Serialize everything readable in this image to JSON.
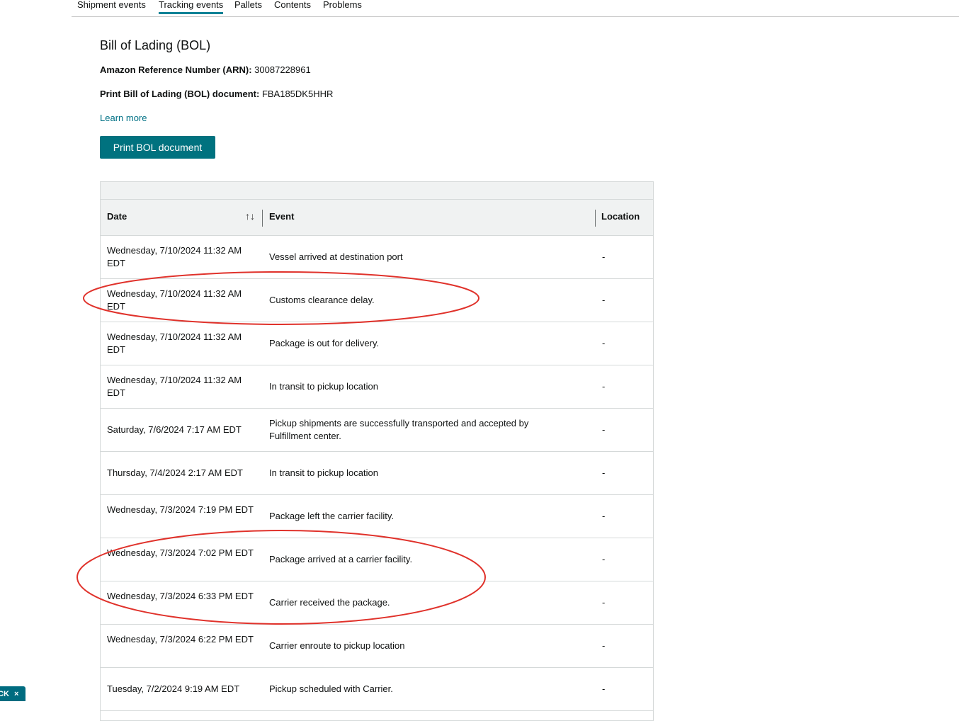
{
  "tabs": [
    "Shipment events",
    "Tracking events",
    "Pallets",
    "Contents",
    "Problems"
  ],
  "active_tab": "Tracking events",
  "bol": {
    "title": "Bill of Lading (BOL)",
    "arn_label": "Amazon Reference Number (ARN):",
    "arn_value": "30087228961",
    "doc_label": "Print Bill of Lading (BOL) document:",
    "doc_value": "FBA185DK5HHR",
    "learn_more": "Learn more",
    "print_button": "Print BOL document"
  },
  "table": {
    "headers": {
      "date": "Date",
      "event": "Event",
      "location": "Location"
    },
    "sort_icon": "↑↓",
    "rows": [
      {
        "date": "Wednesday, 7/10/2024 11:32 AM EDT",
        "event": "Vessel arrived at destination port",
        "location": "-"
      },
      {
        "date": "Wednesday, 7/10/2024 11:32 AM EDT",
        "event": "Customs clearance delay.",
        "location": "-"
      },
      {
        "date": "Wednesday, 7/10/2024 11:32 AM EDT",
        "event": "Package is out for delivery.",
        "location": "-"
      },
      {
        "date": "Wednesday, 7/10/2024 11:32 AM EDT",
        "event": "In transit to pickup location",
        "location": "-"
      },
      {
        "date": "Saturday, 7/6/2024 7:17 AM EDT",
        "event": "Pickup shipments are successfully transported and accepted by Fulfillment center.",
        "location": "-"
      },
      {
        "date": "Thursday, 7/4/2024 2:17 AM EDT",
        "event": "In transit to pickup location",
        "location": "-"
      },
      {
        "date": "Wednesday, 7/3/2024 7:19 PM EDT",
        "event": "Package left the carrier facility.",
        "location": "-"
      },
      {
        "date": "Wednesday, 7/3/2024 7:02 PM EDT",
        "event": "Package arrived at a carrier facility.",
        "location": "-"
      },
      {
        "date": "Wednesday, 7/3/2024 6:33 PM EDT",
        "event": "Carrier received the package.",
        "location": "-"
      },
      {
        "date": "Wednesday, 7/3/2024 6:22 PM EDT",
        "event": "Carrier enroute to pickup location",
        "location": "-"
      },
      {
        "date": "Tuesday, 7/2/2024 9:19 AM EDT",
        "event": "Pickup scheduled with Carrier.",
        "location": "-"
      }
    ]
  },
  "feedback": {
    "label": "CK",
    "close": "×"
  },
  "colors": {
    "accent": "#008296",
    "button": "#00727f",
    "annotation": "#e0322b"
  }
}
